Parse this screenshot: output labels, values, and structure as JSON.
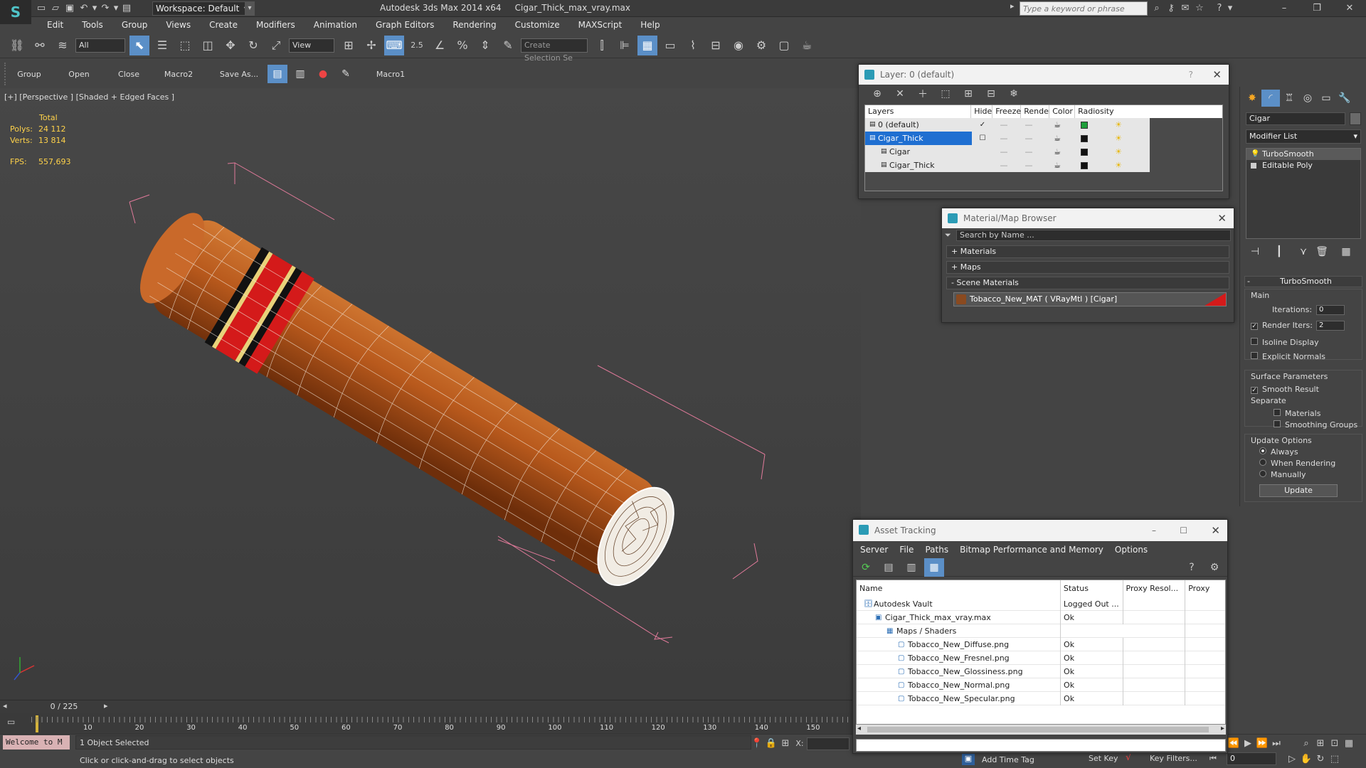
{
  "titlebar": {
    "workspace": "Workspace: Default",
    "app_name": "Autodesk 3ds Max  2014 x64",
    "file_name": "Cigar_Thick_max_vray.max",
    "search_placeholder": "Type a keyword or phrase"
  },
  "menubar": [
    "Edit",
    "Tools",
    "Group",
    "Views",
    "Create",
    "Modifiers",
    "Animation",
    "Graph Editors",
    "Rendering",
    "Customize",
    "MAXScript",
    "Help"
  ],
  "toolbar": {
    "filter_value": "All",
    "refcoord_value": "View",
    "selection_set_placeholder": "Create Selection Se",
    "snap_labels": [
      "2.5",
      "%"
    ]
  },
  "toolbar2": {
    "labels": [
      "Group",
      "Open",
      "Close",
      "Macro2",
      "Save As..."
    ],
    "macro1": "Macro1"
  },
  "viewport": {
    "label": "[+] [Perspective ] [Shaded + Edged Faces ]",
    "stats_header": "Total",
    "polys_label": "Polys:",
    "polys_value": "24 112",
    "verts_label": "Verts:",
    "verts_value": "13 814",
    "fps_label": "FPS:",
    "fps_value": "557,693"
  },
  "timeline": {
    "frame": "0 / 225",
    "ticks": [
      "10",
      "20",
      "30",
      "40",
      "50",
      "60",
      "70",
      "80",
      "90",
      "100",
      "110",
      "120",
      "130",
      "140",
      "150"
    ]
  },
  "status": {
    "maxscript": "Welcome to M",
    "selection": "1 Object Selected",
    "prompt": "Click or click-and-drag to select objects",
    "add_time_tag": "Add Time Tag",
    "set_key": "Set Key",
    "key_filters": "Key Filters...",
    "frame_value": "0",
    "coord_x": "X:"
  },
  "layer_dialog": {
    "title": "Layer: 0 (default)",
    "help": "?",
    "columns": [
      "Layers",
      "Hide",
      "Freeze",
      "Render",
      "Color",
      "Radiosity"
    ],
    "rows": [
      {
        "name": "0 (default)",
        "color": "#1e9e3a",
        "current": true
      },
      {
        "name": "Cigar_Thick",
        "color": "#111111",
        "current": false
      },
      {
        "name": "Cigar",
        "color": "#111111",
        "current": false
      },
      {
        "name": "Cigar_Thick",
        "color": "#111111",
        "current": false
      }
    ]
  },
  "material_browser": {
    "title": "Material/Map Browser",
    "search_placeholder": "Search by Name ...",
    "sections": [
      "+ Materials",
      "+ Maps",
      "- Scene Materials"
    ],
    "scene_material": "Tobacco_New_MAT  ( VRayMtl )  [Cigar]"
  },
  "asset_tracking": {
    "title": "Asset Tracking",
    "menu": [
      "Server",
      "File",
      "Paths",
      "Bitmap Performance and Memory",
      "Options"
    ],
    "columns": [
      "Name",
      "Status",
      "Proxy Resol...",
      "Proxy Stat"
    ],
    "rows": [
      {
        "name": "Autodesk Vault",
        "status": "Logged Out ...",
        "indent": 1
      },
      {
        "name": "Cigar_Thick_max_vray.max",
        "status": "Ok",
        "indent": 2
      },
      {
        "name": "Maps / Shaders",
        "status": "",
        "indent": 3
      },
      {
        "name": "Tobacco_New_Diffuse.png",
        "status": "Ok",
        "indent": 4
      },
      {
        "name": "Tobacco_New_Fresnel.png",
        "status": "Ok",
        "indent": 4
      },
      {
        "name": "Tobacco_New_Glossiness.png",
        "status": "Ok",
        "indent": 4
      },
      {
        "name": "Tobacco_New_Normal.png",
        "status": "Ok",
        "indent": 4
      },
      {
        "name": "Tobacco_New_Specular.png",
        "status": "Ok",
        "indent": 4
      }
    ]
  },
  "command_panel": {
    "object_name": "Cigar",
    "modifier_list": "Modifier List",
    "stack": [
      "TurboSmooth",
      "Editable Poly"
    ],
    "rollout_title": "TurboSmooth",
    "main_label": "Main",
    "iterations_label": "Iterations:",
    "iterations_value": "0",
    "render_iters_label": "Render Iters:",
    "render_iters_value": "2",
    "isoline": "Isoline Display",
    "explicit_normals": "Explicit Normals",
    "surface_params": "Surface Parameters",
    "smooth_result": "Smooth Result",
    "separate": "Separate",
    "materials": "Materials",
    "smoothing_groups": "Smoothing Groups",
    "update_options": "Update Options",
    "always": "Always",
    "when_rendering": "When Rendering",
    "manually": "Manually",
    "update_button": "Update"
  },
  "colors": {
    "accent": "#5b8fc7",
    "stats": "#ffd24a",
    "cigar": "#b8591c",
    "band_red": "#d41a1a"
  }
}
